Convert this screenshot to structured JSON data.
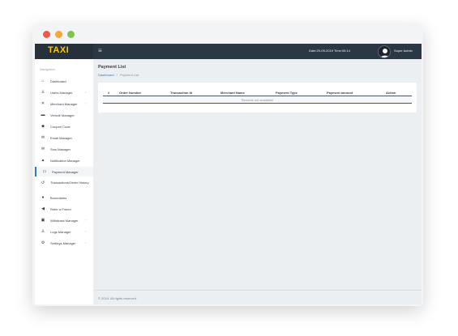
{
  "header": {
    "logo": "TAXI",
    "menu_icon": "≡",
    "datetime": "Date:20-09-2019 Time:05:14",
    "username": "Super Admin"
  },
  "sidebar": {
    "title": "Navigation",
    "items": [
      {
        "label": "Dashboard",
        "icon": "home-icon",
        "has_submenu": false
      },
      {
        "label": "Users Manager",
        "icon": "user-icon",
        "has_submenu": true
      },
      {
        "label": "Merchant Manager",
        "icon": "tools-icon",
        "has_submenu": true
      },
      {
        "label": "Vehicle Manager",
        "icon": "car-icon",
        "has_submenu": false
      },
      {
        "label": "Coupon Code",
        "icon": "tag-icon",
        "has_submenu": false
      },
      {
        "label": "Email Manager",
        "icon": "envelope-icon",
        "has_submenu": false
      },
      {
        "label": "Sms Manager",
        "icon": "envelope-icon",
        "has_submenu": false
      },
      {
        "label": "Notification Manager",
        "icon": "bell-icon",
        "has_submenu": false
      },
      {
        "label": "Payment Manager",
        "icon": "card-icon",
        "has_submenu": false,
        "active": true
      },
      {
        "label": "Transactions/Order History",
        "icon": "history-icon",
        "has_submenu": false
      },
      {
        "label": "Boundaries",
        "icon": "map-pin-icon",
        "has_submenu": false
      },
      {
        "label": "Refer a Friend",
        "icon": "share-icon",
        "has_submenu": false
      },
      {
        "label": "Withdrawl Manager",
        "icon": "cash-icon",
        "has_submenu": true
      },
      {
        "label": "Logs Manager",
        "icon": "user-icon",
        "has_submenu": true
      },
      {
        "label": "Settings Manager",
        "icon": "gear-icon",
        "has_submenu": true
      }
    ]
  },
  "main": {
    "title": "Payment List",
    "breadcrumb": {
      "link": "Dashboard",
      "separator": "/",
      "current": "Payment List"
    },
    "table": {
      "columns": [
        "#",
        "Order Number",
        "Transaction Id",
        "Merchant Name",
        "Payment Type",
        "Payment amount",
        "Action"
      ],
      "empty_message": "Records not available!"
    }
  },
  "footer": {
    "text": "© 2019. All rights reserved."
  },
  "colors": {
    "logo": "#f7c51a",
    "topbar": "#2c3744",
    "link": "#2f7bbd"
  }
}
